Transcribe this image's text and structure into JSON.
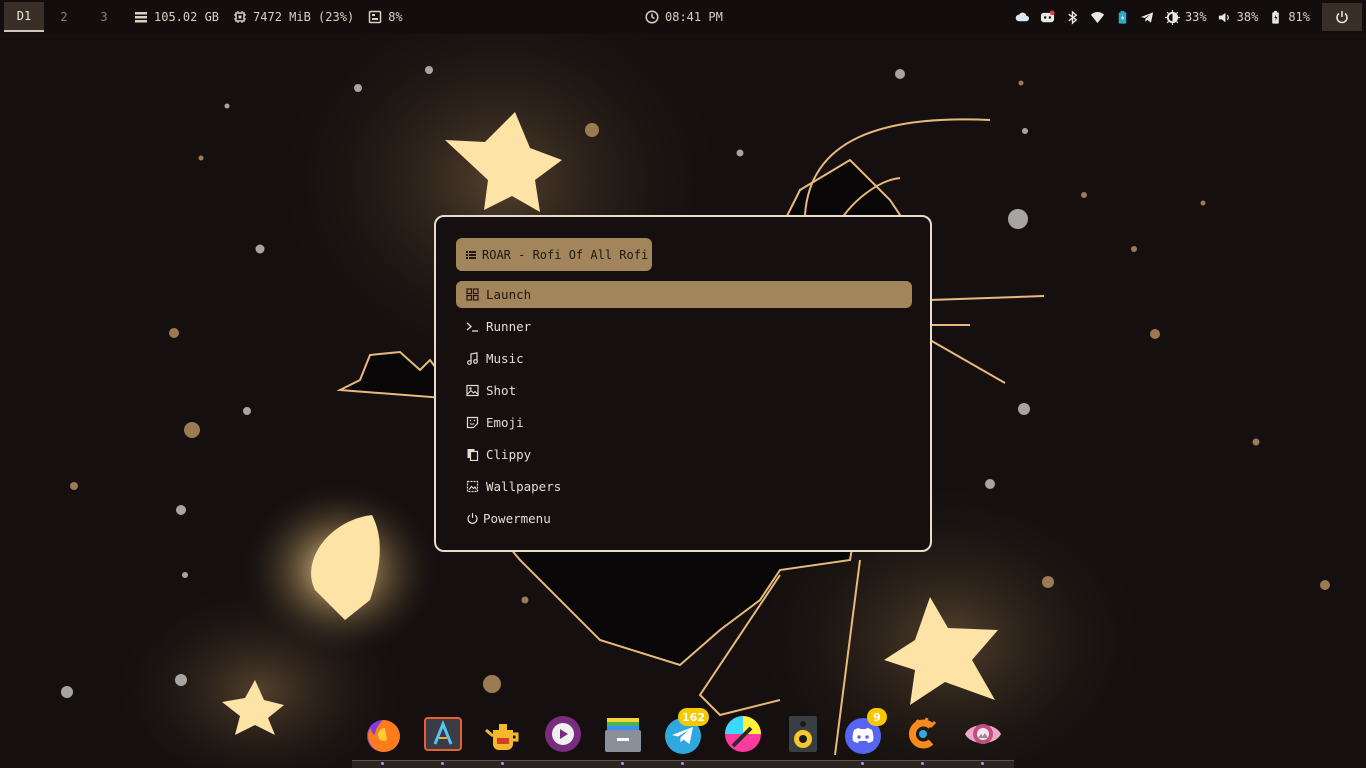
{
  "colors": {
    "accent": "#a3855b",
    "background": "#15100f",
    "border": "#e8dccb",
    "text": "#e6dccf"
  },
  "topbar": {
    "workspaces": [
      {
        "label": "D1",
        "active": true
      },
      {
        "label": "2",
        "active": false
      },
      {
        "label": "3",
        "active": false
      }
    ],
    "disk": {
      "icon": "disk-icon",
      "value": "105.02 GB"
    },
    "memory": {
      "icon": "memory-chip-icon",
      "value": "7472 MiB (23%)"
    },
    "cpu": {
      "icon": "cpu-icon",
      "value": "8%"
    },
    "clock": {
      "icon": "clock-icon",
      "time": "08:41 PM"
    },
    "tray": {
      "cloud": "cloud-icon",
      "discord": "discord-tray-icon",
      "bluetooth": "bluetooth-icon",
      "wifi": "wifi-icon",
      "battery_app": "battery-app-icon",
      "telegram": "telegram-tray-icon",
      "brightness": {
        "icon": "brightness-icon",
        "value": "33%"
      },
      "volume": {
        "icon": "volume-icon",
        "value": "38%"
      },
      "battery": {
        "icon": "battery-charging-icon",
        "value": "81%"
      }
    },
    "power": "power-icon"
  },
  "rofi": {
    "prompt": "ROAR - Rofi Of All Rofi",
    "items": [
      {
        "label": "Launch",
        "icon": "grid-icon",
        "selected": true
      },
      {
        "label": "Runner",
        "icon": "terminal-icon",
        "selected": false
      },
      {
        "label": "Music",
        "icon": "music-note-icon",
        "selected": false
      },
      {
        "label": "Shot",
        "icon": "image-icon",
        "selected": false
      },
      {
        "label": "Emoji",
        "icon": "sticker-icon",
        "selected": false
      },
      {
        "label": "Clippy",
        "icon": "clipboard-icon",
        "selected": false
      },
      {
        "label": "Wallpapers",
        "icon": "wallpaper-icon",
        "selected": false
      },
      {
        "label": "Powermenu",
        "icon": "power-icon",
        "selected": false
      }
    ]
  },
  "dock": {
    "apps": [
      {
        "name": "firefox",
        "icon": "firefox-icon"
      },
      {
        "name": "alacritty",
        "icon": "terminal-app-icon"
      },
      {
        "name": "teapot",
        "icon": "teapot-icon"
      },
      {
        "name": "music-player",
        "icon": "music-player-icon"
      },
      {
        "name": "file-manager",
        "icon": "file-manager-icon"
      },
      {
        "name": "telegram",
        "icon": "telegram-icon",
        "badge": "162"
      },
      {
        "name": "color-picker",
        "icon": "color-picker-icon"
      },
      {
        "name": "audio-speaker",
        "icon": "speaker-icon"
      },
      {
        "name": "discord",
        "icon": "discord-icon",
        "badge": "9"
      },
      {
        "name": "ccleaner",
        "icon": "cleaner-icon"
      },
      {
        "name": "eye-of-gnome",
        "icon": "image-viewer-icon"
      }
    ]
  }
}
